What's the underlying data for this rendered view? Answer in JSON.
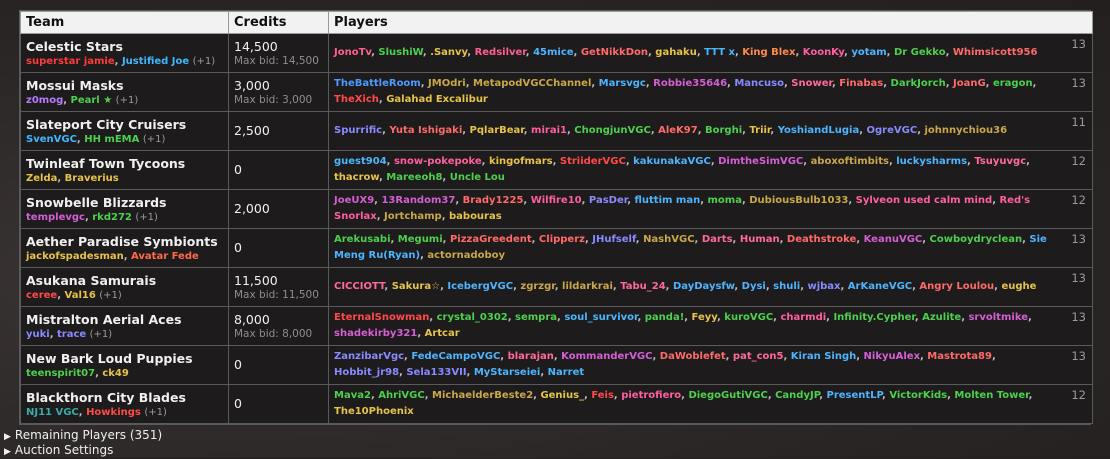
{
  "headers": {
    "team": "Team",
    "credits": "Credits",
    "players": "Players"
  },
  "teams": [
    {
      "name": "Celestic Stars",
      "managers": [
        {
          "name": "superstar jamie",
          "color": "#ff3b3b"
        },
        {
          "name": "Justified Joe",
          "color": "#3fb7ff"
        }
      ],
      "extra": "(+1)",
      "credits": "14,500",
      "maxbid": "Max bid: 14,500",
      "players": [
        {
          "name": "JonoTv",
          "color": "#ff5f8f"
        },
        {
          "name": "SlushiW",
          "color": "#4dd04d"
        },
        {
          "name": ".Sanvy",
          "color": "#e6c34a"
        },
        {
          "name": "Redsilver",
          "color": "#ff5f8f"
        },
        {
          "name": "45mice",
          "color": "#4db5ff"
        },
        {
          "name": "GetNikkDon",
          "color": "#ff6a6a"
        },
        {
          "name": "gahaku",
          "color": "#e6c34a"
        },
        {
          "name": "TTT x",
          "color": "#4db5ff"
        },
        {
          "name": "King Blex",
          "color": "#ff8a4a"
        },
        {
          "name": "KoonKy",
          "color": "#ff5fa0"
        },
        {
          "name": "yotam",
          "color": "#4db5ff"
        },
        {
          "name": "Dr Gekko",
          "color": "#4dd04d"
        },
        {
          "name": "Whimsicott956",
          "color": "#ff6a6a"
        }
      ],
      "count": "13"
    },
    {
      "name": "Mossui Masks",
      "managers": [
        {
          "name": "z0mog",
          "color": "#b57bff"
        },
        {
          "name": "Pearl ★",
          "color": "#4dd04d"
        }
      ],
      "extra": "(+1)",
      "credits": "3,000",
      "maxbid": "Max bid: 3,000",
      "players": [
        {
          "name": "TheBattleRoom",
          "color": "#4d9bff"
        },
        {
          "name": "JMOdri",
          "color": "#c9a84a"
        },
        {
          "name": "MetapodVGCChannel",
          "color": "#c9a84a"
        },
        {
          "name": "Marsvgc",
          "color": "#4db5ff"
        },
        {
          "name": "Robbie35646",
          "color": "#d45fd4"
        },
        {
          "name": "Mancuso",
          "color": "#8a8aff"
        },
        {
          "name": "Snower",
          "color": "#ff6a9a"
        },
        {
          "name": "Finabas",
          "color": "#ff6a6a"
        },
        {
          "name": "DarkJorch",
          "color": "#4dd04d"
        },
        {
          "name": "JoanG",
          "color": "#ff6a6a"
        },
        {
          "name": "eragon",
          "color": "#4dd04d"
        },
        {
          "name": "TheXich",
          "color": "#ff4a4a"
        },
        {
          "name": "Galahad Excalibur",
          "color": "#e6c34a"
        }
      ],
      "count": "13"
    },
    {
      "name": "Slateport City Cruisers",
      "managers": [
        {
          "name": "SvenVGC",
          "color": "#3fb7ff"
        },
        {
          "name": "HH mEMA",
          "color": "#4dd04d"
        }
      ],
      "extra": "(+1)",
      "credits": "2,500",
      "maxbid": "",
      "players": [
        {
          "name": "Spurrific",
          "color": "#8a8aff"
        },
        {
          "name": "Yuta Ishigaki",
          "color": "#ff6a6a"
        },
        {
          "name": "PqlarBear",
          "color": "#e6c34a"
        },
        {
          "name": "mirai1",
          "color": "#ff5fa0"
        },
        {
          "name": "ChongjunVGC",
          "color": "#4dd04d"
        },
        {
          "name": "AleK97",
          "color": "#ff6a6a"
        },
        {
          "name": "Borghi",
          "color": "#4dd04d"
        },
        {
          "name": "Triir",
          "color": "#e6c34a"
        },
        {
          "name": "YoshiandLugia",
          "color": "#4db5ff"
        },
        {
          "name": "OgreVGC",
          "color": "#8a8aff"
        },
        {
          "name": "johnnychiou36",
          "color": "#c9a84a"
        }
      ],
      "count": "11"
    },
    {
      "name": "Twinleaf Town Tycoons",
      "managers": [
        {
          "name": "Zelda",
          "color": "#e6c34a"
        },
        {
          "name": "Braverius",
          "color": "#e6c34a"
        }
      ],
      "extra": "",
      "credits": "0",
      "maxbid": "",
      "players": [
        {
          "name": "guest904",
          "color": "#4db5ff"
        },
        {
          "name": "snow-pokepoke",
          "color": "#ff5fa0"
        },
        {
          "name": "kingofmars",
          "color": "#e6c34a"
        },
        {
          "name": "StriiderVGC",
          "color": "#ff4a4a"
        },
        {
          "name": "kakunakaVGC",
          "color": "#4db5ff"
        },
        {
          "name": "DimtheSimVGC",
          "color": "#d45fd4"
        },
        {
          "name": "aboxoftimbits",
          "color": "#c9a84a"
        },
        {
          "name": "luckysharms",
          "color": "#4db5ff"
        },
        {
          "name": "Tsuyuvgc",
          "color": "#ff6a9a"
        },
        {
          "name": "thacrow",
          "color": "#e6c34a"
        },
        {
          "name": "Mareeoh8",
          "color": "#4dd04d"
        },
        {
          "name": "Uncle Lou",
          "color": "#4dd04d"
        }
      ],
      "count": "12"
    },
    {
      "name": "Snowbelle Blizzards",
      "managers": [
        {
          "name": "templevgc",
          "color": "#d45fd4"
        },
        {
          "name": "rkd272",
          "color": "#4dd04d"
        }
      ],
      "extra": "(+1)",
      "credits": "2,000",
      "maxbid": "",
      "players": [
        {
          "name": "JoeUX9",
          "color": "#d45fd4"
        },
        {
          "name": "13Random37",
          "color": "#d45fd4"
        },
        {
          "name": "Brady1225",
          "color": "#ff6a6a"
        },
        {
          "name": "Wilfire10",
          "color": "#ff5fa0"
        },
        {
          "name": "PasDer",
          "color": "#8a8aff"
        },
        {
          "name": "fluttim man",
          "color": "#4db5ff"
        },
        {
          "name": "moma",
          "color": "#4dd04d"
        },
        {
          "name": "DubiousBulb1033",
          "color": "#c9a84a"
        },
        {
          "name": "Sylveon used calm mind",
          "color": "#ff5fa0"
        },
        {
          "name": "Red's Snorlax",
          "color": "#ff5fa0"
        },
        {
          "name": "Jortchamp",
          "color": "#c9a84a"
        },
        {
          "name": "babouras",
          "color": "#e6c34a"
        }
      ],
      "count": "12"
    },
    {
      "name": "Aether Paradise Symbionts",
      "managers": [
        {
          "name": "jackofspadesman",
          "color": "#e6c34a"
        },
        {
          "name": "Avatar Fede",
          "color": "#ff6a4a"
        }
      ],
      "extra": "",
      "credits": "0",
      "maxbid": "",
      "players": [
        {
          "name": "Arekusabi",
          "color": "#4dd04d"
        },
        {
          "name": "Megumi",
          "color": "#4dd04d"
        },
        {
          "name": "PizzaGreedent",
          "color": "#ff6a6a"
        },
        {
          "name": "Clipperz",
          "color": "#ff6a6a"
        },
        {
          "name": "JHufself",
          "color": "#8a8aff"
        },
        {
          "name": "NashVGC",
          "color": "#c9a84a"
        },
        {
          "name": "Darts",
          "color": "#ff6a9a"
        },
        {
          "name": "Human",
          "color": "#ff6a9a"
        },
        {
          "name": "Deathstroke",
          "color": "#ff6a6a"
        },
        {
          "name": "KeanuVGC",
          "color": "#d45fd4"
        },
        {
          "name": "Cowboydryclean",
          "color": "#4dd04d"
        },
        {
          "name": "Sie Meng Ru(Ryan)",
          "color": "#4db5ff"
        },
        {
          "name": "actornadoboy",
          "color": "#c9a84a"
        }
      ],
      "count": "13"
    },
    {
      "name": "Asukana Samurais",
      "managers": [
        {
          "name": "ceree",
          "color": "#ff4a4a"
        },
        {
          "name": "Val16",
          "color": "#e6c34a"
        }
      ],
      "extra": "(+1)",
      "credits": "11,500",
      "maxbid": "Max bid: 11,500",
      "players": [
        {
          "name": "CICCIOTT",
          "color": "#ff6a9a"
        },
        {
          "name": "Sakura☆",
          "color": "#e6c34a"
        },
        {
          "name": "IcebergVGC",
          "color": "#4db5ff"
        },
        {
          "name": "zgrzgr",
          "color": "#c9a84a"
        },
        {
          "name": "lildarkrai",
          "color": "#c9a84a"
        },
        {
          "name": "Tabu_24",
          "color": "#ff6a9a"
        },
        {
          "name": "DayDaysfw",
          "color": "#4db5ff"
        },
        {
          "name": "Dysi",
          "color": "#4db5ff"
        },
        {
          "name": "shuli",
          "color": "#4db5ff"
        },
        {
          "name": "wjbax",
          "color": "#8a8aff"
        },
        {
          "name": "ArKaneVGC",
          "color": "#4db5ff"
        },
        {
          "name": "Angry Loulou",
          "color": "#ff6a6a"
        },
        {
          "name": "eughe",
          "color": "#e6c34a"
        }
      ],
      "count": "13"
    },
    {
      "name": "Mistralton Aerial Aces",
      "managers": [
        {
          "name": "yuki",
          "color": "#8a8aff"
        },
        {
          "name": "trace",
          "color": "#8a8aff"
        }
      ],
      "extra": "(+1)",
      "credits": "8,000",
      "maxbid": "Max bid: 8,000",
      "players": [
        {
          "name": "EternalSnowman",
          "color": "#ff4a4a"
        },
        {
          "name": "crystal_0302",
          "color": "#4dd04d"
        },
        {
          "name": "sempra",
          "color": "#4dd04d"
        },
        {
          "name": "soul_survivor",
          "color": "#4db5ff"
        },
        {
          "name": "panda!",
          "color": "#4dd04d"
        },
        {
          "name": "Feyy",
          "color": "#e6c34a"
        },
        {
          "name": "kuroVGC",
          "color": "#4dd04d"
        },
        {
          "name": "charmdi",
          "color": "#ff5fa0"
        },
        {
          "name": "Infinity.Cypher",
          "color": "#4dd04d"
        },
        {
          "name": "Azulite",
          "color": "#4dd04d"
        },
        {
          "name": "srvoltmike",
          "color": "#d45fd4"
        },
        {
          "name": "shadekirby321",
          "color": "#d45fd4"
        },
        {
          "name": "Artcar",
          "color": "#e6c34a"
        }
      ],
      "count": "13"
    },
    {
      "name": "New Bark Loud Puppies",
      "managers": [
        {
          "name": "teenspirit07",
          "color": "#4dd04d"
        },
        {
          "name": "ck49",
          "color": "#e6c34a"
        }
      ],
      "extra": "",
      "credits": "0",
      "maxbid": "",
      "players": [
        {
          "name": "ZanzibarVgc",
          "color": "#8a8aff"
        },
        {
          "name": "FedeCampoVGC",
          "color": "#4db5ff"
        },
        {
          "name": "blarajan",
          "color": "#ff6a9a"
        },
        {
          "name": "KommanderVGC",
          "color": "#d45fd4"
        },
        {
          "name": "DaWoblefet",
          "color": "#ff6a6a"
        },
        {
          "name": "pat_con5",
          "color": "#ff6a9a"
        },
        {
          "name": "Kiran Singh",
          "color": "#4db5ff"
        },
        {
          "name": "NikyuAlex",
          "color": "#d45fd4"
        },
        {
          "name": "Mastrota89",
          "color": "#ff6a6a"
        },
        {
          "name": "Hobbit_jr98",
          "color": "#8a8aff"
        },
        {
          "name": "Sela133VII",
          "color": "#8a8aff"
        },
        {
          "name": "MyStarseiei",
          "color": "#4db5ff"
        },
        {
          "name": "Narret",
          "color": "#4db5ff"
        }
      ],
      "count": "13"
    },
    {
      "name": "Blackthorn City Blades",
      "managers": [
        {
          "name": "NJ11 VGC",
          "color": "#3aaaaa"
        },
        {
          "name": "Howkings",
          "color": "#ff4a4a"
        }
      ],
      "extra": "(+1)",
      "credits": "0",
      "maxbid": "",
      "players": [
        {
          "name": "Mava2",
          "color": "#4dd04d"
        },
        {
          "name": "AhriVGC",
          "color": "#4dd04d"
        },
        {
          "name": "MichaelderBeste2",
          "color": "#c9a84a"
        },
        {
          "name": "Genius_",
          "color": "#e6c34a"
        },
        {
          "name": "Feis",
          "color": "#ff4a4a"
        },
        {
          "name": "pietrofiero",
          "color": "#ff5fa0"
        },
        {
          "name": "DiegoGutiVGC",
          "color": "#4dd04d"
        },
        {
          "name": "CandyJP",
          "color": "#4dd04d"
        },
        {
          "name": "PresentLP",
          "color": "#4db5ff"
        },
        {
          "name": "VictorKids",
          "color": "#4dd04d"
        },
        {
          "name": "Molten Tower",
          "color": "#4dd04d"
        },
        {
          "name": "The10Phoenix",
          "color": "#e6c34a"
        }
      ],
      "count": "12"
    }
  ],
  "footer": {
    "remaining": "Remaining Players (351)",
    "settings": "Auction Settings"
  },
  "icons": {
    "expand": "triangle-right-icon"
  }
}
